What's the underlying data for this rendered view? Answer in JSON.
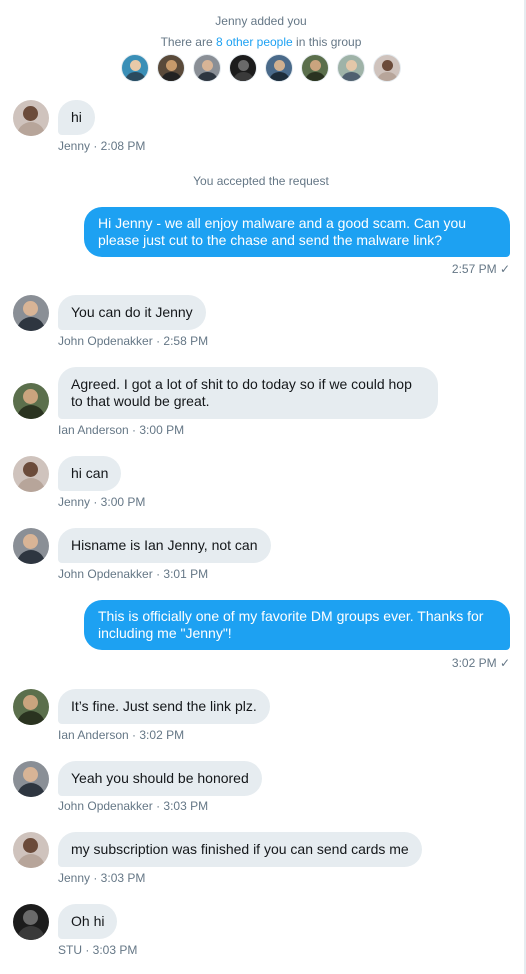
{
  "header": {
    "added_text": "Jenny added you",
    "others_prefix": "There are ",
    "others_link": "8 other people",
    "others_suffix": " in this group"
  },
  "group_avatars": [
    "avatar-1",
    "avatar-2",
    "avatar-3",
    "avatar-4",
    "avatar-5",
    "avatar-6",
    "avatar-7",
    "avatar-8"
  ],
  "accepted_text": "You accepted the request",
  "messages": [
    {
      "sender": "Jenny",
      "text": "hi",
      "meta": "Jenny · 2:08 PM"
    },
    {
      "sender": "me",
      "text": "Hi Jenny - we all enjoy malware and a good scam. Can you please just cut to the chase and send the malware link?",
      "meta": "2:57 PM"
    },
    {
      "sender": "John Opdenakker",
      "text": "You can do it Jenny",
      "meta": "John Opdenakker · 2:58 PM"
    },
    {
      "sender": "Ian Anderson",
      "text": "Agreed. I got a lot of shit to do today so if we could hop to that would be great.",
      "meta": "Ian Anderson · 3:00 PM"
    },
    {
      "sender": "Jenny",
      "text": "hi can",
      "meta": "Jenny · 3:00 PM"
    },
    {
      "sender": "John Opdenakker",
      "text": "Hisname is Ian Jenny, not can",
      "meta": "John Opdenakker · 3:01 PM"
    },
    {
      "sender": "me",
      "text": "This is officially one of my favorite DM groups ever. Thanks for including me \"Jenny\"!",
      "meta": "3:02 PM"
    },
    {
      "sender": "Ian Anderson",
      "text": "It’s fine. Just send the link plz.",
      "meta": "Ian Anderson · 3:02 PM"
    },
    {
      "sender": "John Opdenakker",
      "text": "Yeah you should be honored",
      "meta": "John Opdenakker · 3:03 PM"
    },
    {
      "sender": "Jenny",
      "text": "my subscription was finished if you can send cards me",
      "meta": "Jenny · 3:03 PM"
    },
    {
      "sender": "STU",
      "text": "Oh hi",
      "meta": "STU · 3:03 PM"
    }
  ],
  "read_check": "✓",
  "colors": {
    "accent": "#1da1f2",
    "bubble_in": "#e6ecf0",
    "meta": "#657786"
  }
}
